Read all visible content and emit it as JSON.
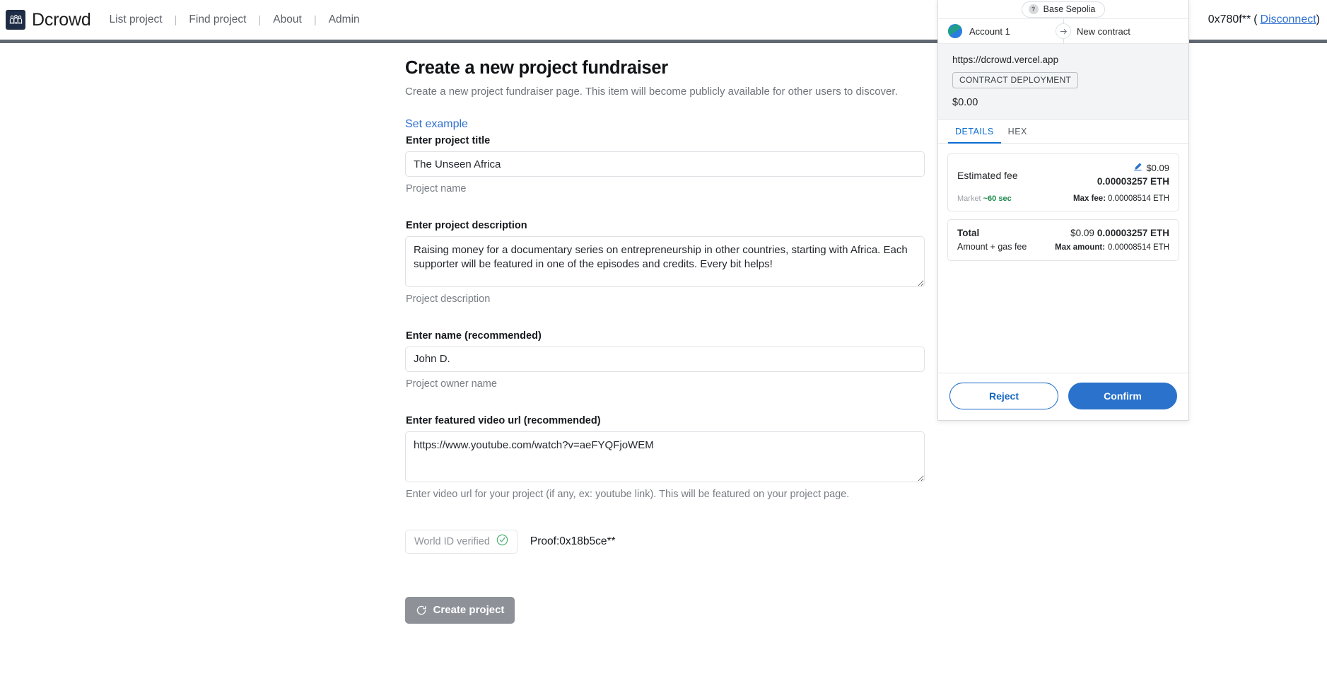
{
  "nav": {
    "brand": "Dcrowd",
    "logo_icon": "people-group-icon",
    "links": [
      {
        "label": "List project"
      },
      {
        "label": "Find project"
      },
      {
        "label": "About"
      },
      {
        "label": "Admin"
      }
    ],
    "separator": "|",
    "wallet": {
      "address": "0x780f**",
      "open_paren": "(",
      "disconnect_label": "Disconnect",
      "close_paren": ")"
    }
  },
  "form": {
    "title": "Create a new project fundraiser",
    "subtitle": "Create a new project fundraiser page. This item will become publicly available for other users to discover.",
    "set_example_label": "Set example",
    "fields": [
      {
        "label": "Enter project title",
        "value": "The Unseen Africa",
        "help": "Project name",
        "type": "input"
      },
      {
        "label": "Enter project description",
        "value": "Raising money for a documentary series on entrepreneurship in other countries, starting with Africa. Each supporter will be featured in one of the episodes and credits. Every bit helps!",
        "help": "Project description",
        "type": "textarea"
      },
      {
        "label": "Enter name (recommended)",
        "value": "John D.",
        "help": "Project owner name",
        "type": "input"
      },
      {
        "label": "Enter featured video url (recommended)",
        "value": "https://www.youtube.com/watch?v=aeFYQFjoWEM",
        "help": "Enter video url for your project (if any, ex: youtube link). This will be featured on your project page.",
        "type": "textarea"
      }
    ],
    "worldid": {
      "chip_label": "World ID verified",
      "chip_icon": "check-circle-icon",
      "proof_text": "Proof:0x18b5ce**"
    },
    "submit": {
      "label": "Create project",
      "icon": "spinner-icon",
      "disabled_color": "#8e9298"
    }
  },
  "metamask": {
    "network": {
      "label": "Base Sepolia",
      "icon": "question-mark-icon"
    },
    "account": {
      "from_label": "Account 1",
      "avatar_icon": "account-avatar-icon",
      "arrow_icon": "arrow-right-icon",
      "to_label": "New contract"
    },
    "origin": {
      "url": "https://dcrowd.vercel.app",
      "tag": "CONTRACT DEPLOYMENT",
      "amount": "$0.00"
    },
    "tabs": [
      {
        "label": "DETAILS",
        "active": true
      },
      {
        "label": "HEX",
        "active": false
      }
    ],
    "fee": {
      "label": "Estimated fee",
      "edit_icon": "pencil-edit-icon",
      "usd": "$0.09",
      "eth": "0.00003257 ETH",
      "market_label": "Market",
      "market_time": "~60 sec",
      "max_fee_label": "Max fee:",
      "max_fee_value": "0.00008514 ETH"
    },
    "total": {
      "label": "Total",
      "usd": "$0.09",
      "eth": "0.00003257 ETH",
      "sub_label": "Amount + gas fee",
      "max_amount_label": "Max amount:",
      "max_amount_value": "0.00008514 ETH"
    },
    "actions": {
      "reject_label": "Reject",
      "confirm_label": "Confirm",
      "confirm_color": "#2a72cc",
      "reject_color": "#1668c4"
    }
  }
}
